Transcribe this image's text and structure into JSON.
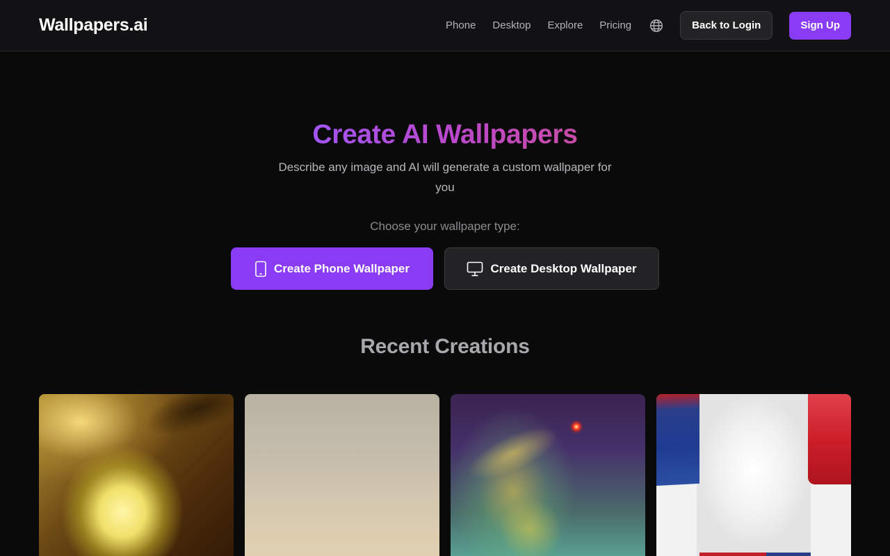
{
  "header": {
    "logo": "Wallpapers.ai",
    "nav": [
      {
        "label": "Phone"
      },
      {
        "label": "Desktop"
      },
      {
        "label": "Explore"
      },
      {
        "label": "Pricing"
      }
    ],
    "language_icon": "globe-icon",
    "login_label": "Back to Login",
    "signup_label": "Sign Up"
  },
  "hero": {
    "title": "Create AI Wallpapers",
    "subtitle": "Describe any image and AI will generate a custom wallpaper for you",
    "choose_label": "Choose your wallpaper type:",
    "phone_button": "Create Phone Wallpaper",
    "phone_icon": "smartphone-icon",
    "desktop_button": "Create Desktop Wallpaper",
    "desktop_icon": "monitor-icon"
  },
  "recent": {
    "title": "Recent Creations",
    "cards": [
      {
        "id": 1
      },
      {
        "id": 2
      },
      {
        "id": 3
      },
      {
        "id": 4
      }
    ]
  },
  "colors": {
    "accent": "#8a3cf5",
    "background": "#0a0a0b",
    "header_bg": "#121214",
    "title_gradient_start": "#a255f2",
    "title_gradient_end": "#c94da7"
  }
}
